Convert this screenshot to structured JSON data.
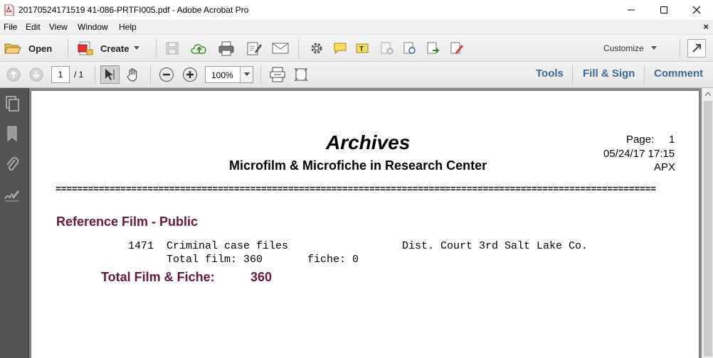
{
  "window": {
    "title": "20170524171519 41-086-PRTFI005.pdf - Adobe Acrobat Pro",
    "controls": {
      "minimize_icon": "minimize-icon",
      "maximize_icon": "maximize-icon",
      "close_icon": "close-icon"
    }
  },
  "menu": {
    "items": [
      "File",
      "Edit",
      "View",
      "Window",
      "Help"
    ],
    "close_doc": "×"
  },
  "toolbar": {
    "open_label": "Open",
    "create_label": "Create",
    "customize_label": "Customize"
  },
  "nav": {
    "current_page": "1",
    "total_pages": "/ 1",
    "zoom": "100%"
  },
  "panes": {
    "tools": "Tools",
    "fill_sign": "Fill & Sign",
    "comment": "Comment"
  },
  "document": {
    "title": "Archives",
    "subtitle": "Microfilm & Microfiche in Research Center",
    "page_label": "Page:",
    "page_number": "1",
    "datetime": "05/24/17 17:15",
    "code": "APX",
    "rule": "===============================================================================================================",
    "section": "Reference Film - Public",
    "entry": {
      "number": "1471",
      "description": "Criminal case files",
      "agency": "Dist. Court 3rd Salt Lake Co.",
      "totals_line": "Total film: 360       fiche: 0"
    },
    "total_label": "Total Film & Fiche:",
    "total_value": "360"
  },
  "colors": {
    "section_text": "#6b1640",
    "pane_link": "#3c6a9a",
    "left_panel": "#535353",
    "doc_background": "#8a8a8a"
  }
}
